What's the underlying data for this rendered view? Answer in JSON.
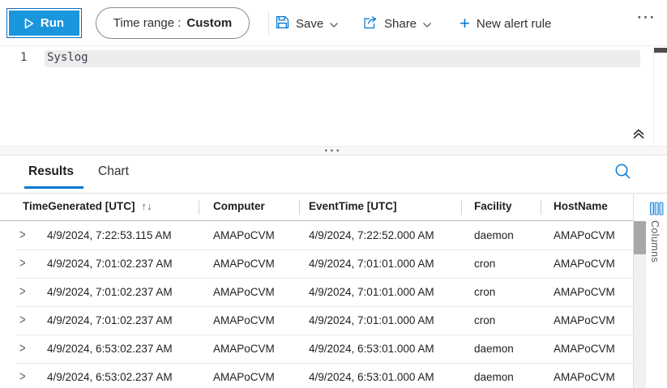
{
  "toolbar": {
    "run_label": "Run",
    "time_range_label": "Time range :",
    "time_range_value": "Custom",
    "save_label": "Save",
    "share_label": "Share",
    "new_alert_rule_label": "New alert rule",
    "plus_icon": "+",
    "more_label": "···"
  },
  "editor": {
    "line_number": "1",
    "code": "Syslog"
  },
  "splitter": {
    "dots": "•••"
  },
  "results_panel": {
    "tabs": {
      "results": "Results",
      "chart": "Chart"
    },
    "columns_label": "Columns"
  },
  "table": {
    "headers": [
      "TimeGenerated [UTC]",
      "Computer",
      "EventTime [UTC]",
      "Facility",
      "HostName"
    ],
    "sort_icon": "↑↓",
    "row_expander_icon": ">",
    "rows": [
      [
        "4/9/2024, 7:22:53.115 AM",
        "AMAPoCVM",
        "4/9/2024, 7:22:52.000 AM",
        "daemon",
        "AMAPoCVM"
      ],
      [
        "4/9/2024, 7:01:02.237 AM",
        "AMAPoCVM",
        "4/9/2024, 7:01:01.000 AM",
        "cron",
        "AMAPoCVM"
      ],
      [
        "4/9/2024, 7:01:02.237 AM",
        "AMAPoCVM",
        "4/9/2024, 7:01:01.000 AM",
        "cron",
        "AMAPoCVM"
      ],
      [
        "4/9/2024, 7:01:02.237 AM",
        "AMAPoCVM",
        "4/9/2024, 7:01:01.000 AM",
        "cron",
        "AMAPoCVM"
      ],
      [
        "4/9/2024, 6:53:02.237 AM",
        "AMAPoCVM",
        "4/9/2024, 6:53:01.000 AM",
        "daemon",
        "AMAPoCVM"
      ],
      [
        "4/9/2024, 6:53:02.237 AM",
        "AMAPoCVM",
        "4/9/2024, 6:53:01.000 AM",
        "daemon",
        "AMAPoCVM"
      ]
    ]
  },
  "colors": {
    "accent": "#0078d4",
    "run_button": "#1a96dd"
  }
}
